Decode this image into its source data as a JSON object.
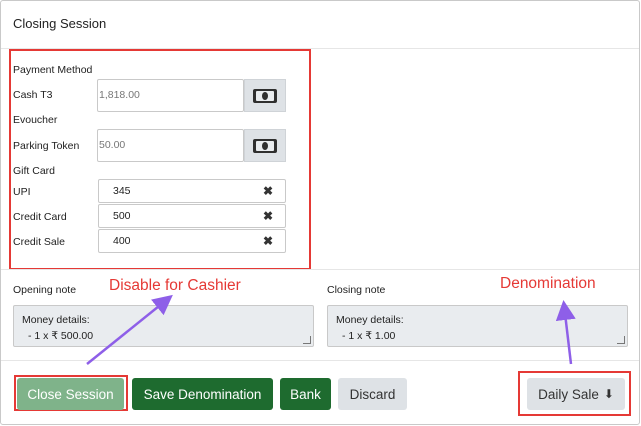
{
  "header": {
    "title": "Closing Session"
  },
  "payment": {
    "section_label": "Payment Method",
    "cash_label": "Cash T3",
    "cash_value": "1,818.00",
    "evoucher_label": "Evoucher",
    "parking_label": "Parking Token",
    "parking_value": "50.00",
    "giftcard_label": "Gift Card",
    "upi_label": "UPI",
    "upi_value": "345",
    "credit_card_label": "Credit Card",
    "credit_card_value": "500",
    "credit_sale_label": "Credit Sale",
    "credit_sale_value": "400",
    "clear_glyph": "✖"
  },
  "notes": {
    "opening_label": "Opening note",
    "opening_line1": "Money details:",
    "opening_line2": "- 1 x ₹ 500.00",
    "closing_label": "Closing note",
    "closing_line1": "Money details:",
    "closing_line2": "- 1 x ₹ 1.00"
  },
  "annotations": {
    "disable_for_cashier": "Disable for Cashier",
    "denomination": "Denomination",
    "color": "#e53935"
  },
  "footer": {
    "close_session": "Close Session",
    "save_denomination": "Save Denomination",
    "bank": "Bank",
    "discard": "Discard",
    "daily_sale": "Daily Sale",
    "download_glyph": "⬇"
  },
  "colors": {
    "primary": "#1e6b2f",
    "disabled": "#7fb38a",
    "light": "#dee2e6"
  },
  "icons": {
    "cash": "money-bill-icon",
    "clear": "close-icon",
    "download": "download-icon"
  }
}
